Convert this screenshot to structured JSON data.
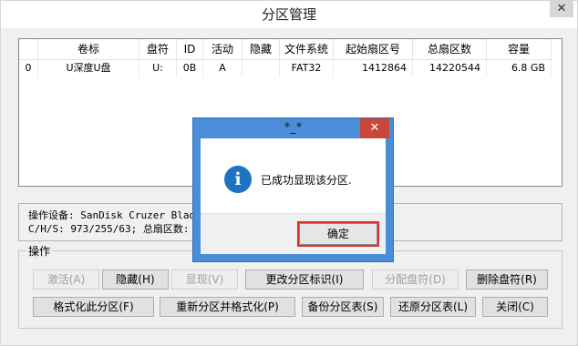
{
  "window": {
    "title": "分区管理",
    "close_label": "✕"
  },
  "table": {
    "columns": [
      "",
      "卷标",
      "盘符",
      "ID",
      "活动",
      "隐藏",
      "文件系统",
      "起始扇区号",
      "总扇区数",
      "容量"
    ],
    "rows": [
      [
        "0",
        "U深度U盘",
        "U:",
        "0B",
        "A",
        "",
        "FAT32",
        "1412864",
        "14220544",
        "6.8 GB"
      ]
    ]
  },
  "device_info": {
    "line1": "操作设备:  SanDisk Cruzer Blad",
    "line2": "C/H/S: 973/255/63; 总扇区数: 15"
  },
  "operations": {
    "group_label": "操作",
    "row1": [
      {
        "label": "激活(A)",
        "disabled": true
      },
      {
        "label": "隐藏(H)",
        "disabled": false
      },
      {
        "label": "显现(V)",
        "disabled": true
      },
      {
        "label": "更改分区标识(I)",
        "disabled": false
      },
      {
        "label": "分配盘符(D)",
        "disabled": true
      },
      {
        "label": "删除盘符(R)",
        "disabled": false
      }
    ],
    "row2": [
      {
        "label": "格式化此分区(F)",
        "disabled": false
      },
      {
        "label": "重新分区并格式化(P)",
        "disabled": false
      },
      {
        "label": "备份分区表(S)",
        "disabled": false
      },
      {
        "label": "还原分区表(L)",
        "disabled": false
      },
      {
        "label": "关闭(C)",
        "disabled": false
      }
    ]
  },
  "dialog": {
    "title": "*_*",
    "close_label": "✕",
    "icon": "info-icon",
    "icon_glyph": "i",
    "message": "已成功显现该分区.",
    "ok_label": "确定"
  }
}
